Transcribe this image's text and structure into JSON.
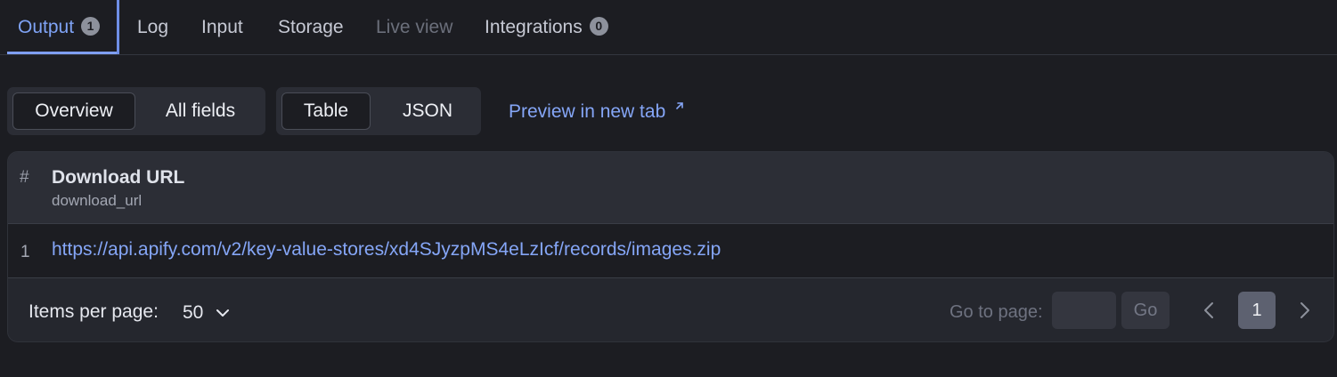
{
  "tabs": [
    {
      "label": "Output",
      "badge": "1",
      "state": "active"
    },
    {
      "label": "Log",
      "state": "normal"
    },
    {
      "label": "Input",
      "state": "normal"
    },
    {
      "label": "Storage",
      "state": "normal"
    },
    {
      "label": "Live view",
      "state": "disabled"
    },
    {
      "label": "Integrations",
      "badge": "0",
      "state": "normal"
    }
  ],
  "view_toggle": {
    "overview": "Overview",
    "all_fields": "All fields",
    "selected": "Overview"
  },
  "format_toggle": {
    "table": "Table",
    "json": "JSON",
    "selected": "Table"
  },
  "preview_link": {
    "label": "Preview in new tab",
    "icon": "external-link-icon"
  },
  "table": {
    "hash_header": "#",
    "column": {
      "title": "Download URL",
      "key": "download_url"
    },
    "rows": [
      {
        "num": "1",
        "download_url": "https://api.apify.com/v2/key-value-stores/xd4SJyzpMS4eLzIcf/records/images.zip"
      }
    ]
  },
  "footer": {
    "items_per_page_label": "Items per page:",
    "items_per_page_value": "50",
    "go_to_page_label": "Go to page:",
    "go_to_page_value": "",
    "go_button": "Go",
    "current_page": "1"
  },
  "colors": {
    "background": "#1c1d22",
    "accent": "#85a6f7",
    "card": "#25272e"
  }
}
